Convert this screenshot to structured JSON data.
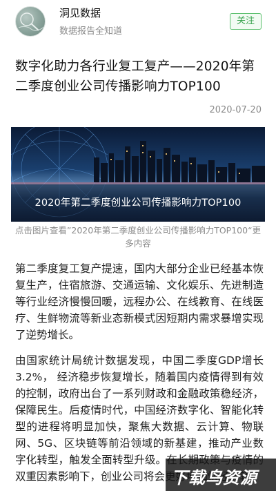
{
  "header": {
    "account_name": "洞见数据",
    "account_desc": "数据报告全知道",
    "follow_label": "关注"
  },
  "article": {
    "title": "数字化助力各行业复工复产——2020年第二季度创业公司传播影响力TOP100",
    "date": "2020-07-20",
    "banner_caption": "2020年第二季度创业公司传播影响力TOP100",
    "image_note": "点击图片查看”2020年第二季度创业公司传播影响力TOP100“更多内容",
    "paragraph1": "第二季度复工复产提速，国内大部分企业已经基本恢复生产，住宿旅游、交通运输、文化娱乐、先进制造等行业经济慢慢回暖，远程办公、在线教育、在线医疗、生鲜物流等新业态新模式因短期内需求暴增实现了逆势增长。",
    "paragraph2": "由国家统计局统计数据发现，中国二季度GDP增长3.2%， 经济稳步恢复增长，随着国内疫情得到有效的控制，政府出台了一系列财政和金融政策稳经济，保障民生。后疫情时代，中国经济数字化、智能化转型的进程将明显加快，聚焦大数据、云计算、物联网、5G、区块链等前沿领域的新基建，推动产业数字化转型，触发全面转型升级。在长期政策与疫情的双重因素影响下，创业公司将会更好地加快经济转"
  },
  "watermark": {
    "text": "下载鸟资源"
  },
  "colors": {
    "accent": "#57be6a",
    "muted_text": "#8a8a8a"
  }
}
